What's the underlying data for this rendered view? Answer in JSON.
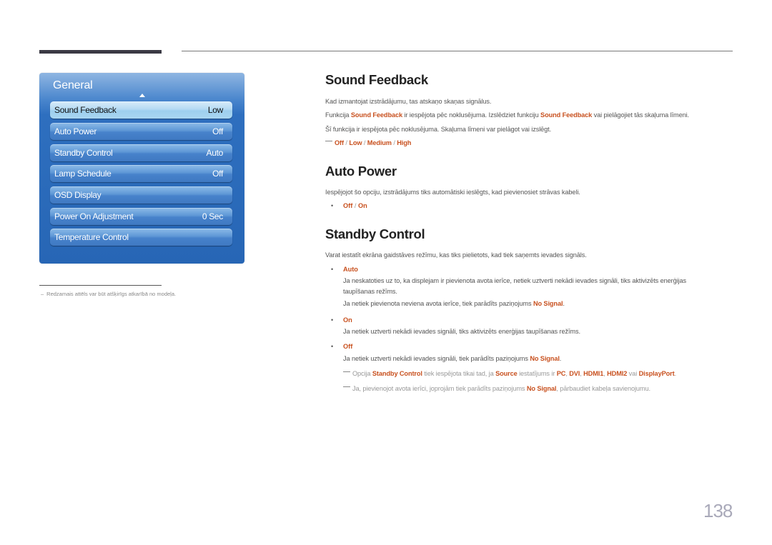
{
  "osd": {
    "title": "General",
    "items": [
      {
        "label": "Sound Feedback",
        "value": "Low",
        "selected": true
      },
      {
        "label": "Auto Power",
        "value": "Off"
      },
      {
        "label": "Standby Control",
        "value": "Auto"
      },
      {
        "label": "Lamp Schedule",
        "value": "Off"
      },
      {
        "label": "OSD Display",
        "value": ""
      },
      {
        "label": "Power On Adjustment",
        "value": "0 Sec"
      },
      {
        "label": "Temperature Control",
        "value": ""
      }
    ]
  },
  "footnote": {
    "dash": "–",
    "text": "Redzamais attēls var būt atšķirīgs atkarībā no modeļa."
  },
  "sound_feedback": {
    "heading": "Sound Feedback",
    "p1": "Kad izmantojat izstrādājumu, tas atskaņo skaņas signālus.",
    "p2_a": "Funkcija ",
    "p2_b": "Sound Feedback",
    "p2_c": " ir iespējota pēc noklusējuma. Izslēdziet funkciju ",
    "p2_d": "Sound Feedback",
    "p2_e": " vai pielāgojiet tās skaļuma līmeni.",
    "p3": "Šī funkcija ir iespējota pēc noklusējuma. Skaļuma līmeni var pielāgot vai izslēgt.",
    "options": [
      "Off",
      "Low",
      "Medium",
      "High"
    ],
    "sep": " / "
  },
  "auto_power": {
    "heading": "Auto Power",
    "p1": "Iespējojot šo opciju, izstrādājums tiks automātiski ieslēgts, kad pievienosiet strāvas kabeli.",
    "options": [
      "Off",
      "On"
    ],
    "sep": " / "
  },
  "standby_control": {
    "heading": "Standby Control",
    "p1": "Varat iestatīt ekrāna gaidstāves režīmu, kas tiks pielietots, kad tiek saņemts ievades signāls.",
    "auto": {
      "label": "Auto",
      "line1": "Ja neskatoties uz to, ka displejam ir pievienota avota ierīce, netiek uztverti nekādi ievades signāli, tiks aktivizēts enerģijas",
      "line2": "taupīšanas režīms.",
      "line3_a": "Ja netiek pievienota neviena avota ierīce, tiek parādīts paziņojums ",
      "line3_b": "No Signal",
      "line3_c": "."
    },
    "on": {
      "label": "On",
      "line1": "Ja netiek uztverti nekādi ievades signāli, tiks aktivizēts enerģijas taupīšanas režīms."
    },
    "off": {
      "label": "Off",
      "line1_a": "Ja netiek uztverti nekādi ievades signāli, tiek parādīts paziņojums ",
      "line1_b": "No Signal",
      "line1_c": "."
    },
    "note1": {
      "a": "Opcija ",
      "b": "Standby Control",
      "c": " tiek iespējota tikai tad, ja ",
      "d": "Source",
      "e": " iestatījums ir ",
      "f": "PC",
      "g": ", ",
      "h": "DVI",
      "i": ", ",
      "j": "HDMI1",
      "k": ", ",
      "l": "HDMI2",
      "m": " vai ",
      "n": "DisplayPort",
      "o": "."
    },
    "note2": {
      "a": "Ja, pievienojot avota ierīci, joprojām tiek parādīts paziņojums ",
      "b": "No Signal",
      "c": ", pārbaudiet kabeļa savienojumu."
    }
  },
  "bullet_char": "•",
  "page_number": "138",
  "colors": {
    "highlight": "#c8501e",
    "osd_blue": "#2766b5",
    "osd_selected": "#b5daf3"
  }
}
